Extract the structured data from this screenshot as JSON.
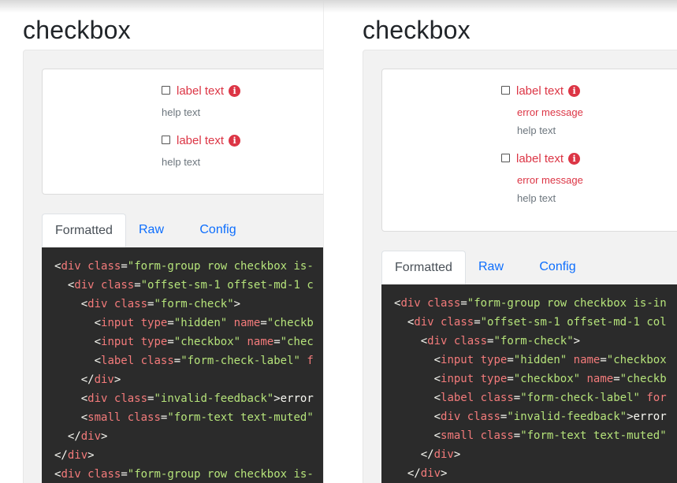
{
  "left": {
    "title": "checkbox",
    "checks": [
      {
        "label": "label text",
        "help": "help text"
      },
      {
        "label": "label text",
        "help": "help text"
      }
    ],
    "tabs": [
      "Formatted",
      "Raw",
      "Config"
    ],
    "code": [
      [
        [
          "<",
          "p"
        ],
        [
          "div",
          "g"
        ],
        [
          " ",
          ""
        ],
        [
          "class",
          "a"
        ],
        [
          "=",
          "p"
        ],
        [
          "\"form-group row checkbox is-",
          "v"
        ]
      ],
      [
        [
          "  ",
          ""
        ],
        [
          "<",
          "p"
        ],
        [
          "div",
          "g"
        ],
        [
          " ",
          ""
        ],
        [
          "class",
          "a"
        ],
        [
          "=",
          "p"
        ],
        [
          "\"offset-sm-1 offset-md-1 c",
          "v"
        ]
      ],
      [
        [
          "    ",
          ""
        ],
        [
          "<",
          "p"
        ],
        [
          "div",
          "g"
        ],
        [
          " ",
          ""
        ],
        [
          "class",
          "a"
        ],
        [
          "=",
          "p"
        ],
        [
          "\"form-check\"",
          "v"
        ],
        [
          ">",
          "p"
        ]
      ],
      [
        [
          "      ",
          ""
        ],
        [
          "<",
          "p"
        ],
        [
          "input",
          "g"
        ],
        [
          " ",
          ""
        ],
        [
          "type",
          "a"
        ],
        [
          "=",
          "p"
        ],
        [
          "\"hidden\"",
          "v"
        ],
        [
          " ",
          ""
        ],
        [
          "name",
          "a"
        ],
        [
          "=",
          "p"
        ],
        [
          "\"checkb",
          "v"
        ]
      ],
      [
        [
          "      ",
          ""
        ],
        [
          "<",
          "p"
        ],
        [
          "input",
          "g"
        ],
        [
          " ",
          ""
        ],
        [
          "type",
          "a"
        ],
        [
          "=",
          "p"
        ],
        [
          "\"checkbox\"",
          "v"
        ],
        [
          " ",
          ""
        ],
        [
          "name",
          "a"
        ],
        [
          "=",
          "p"
        ],
        [
          "\"chec",
          "v"
        ]
      ],
      [
        [
          "      ",
          ""
        ],
        [
          "<",
          "p"
        ],
        [
          "label",
          "g"
        ],
        [
          " ",
          ""
        ],
        [
          "class",
          "a"
        ],
        [
          "=",
          "p"
        ],
        [
          "\"form-check-label\"",
          "v"
        ],
        [
          " ",
          ""
        ],
        [
          "f",
          "a"
        ]
      ],
      [
        [
          "    ",
          ""
        ],
        [
          "</",
          "p"
        ],
        [
          "div",
          "g"
        ],
        [
          ">",
          "p"
        ]
      ],
      [
        [
          "    ",
          ""
        ],
        [
          "<",
          "p"
        ],
        [
          "div",
          "g"
        ],
        [
          " ",
          ""
        ],
        [
          "class",
          "a"
        ],
        [
          "=",
          "p"
        ],
        [
          "\"invalid-feedback\"",
          "v"
        ],
        [
          ">",
          "p"
        ],
        [
          "error",
          "t"
        ]
      ],
      [
        [
          "    ",
          ""
        ],
        [
          "<",
          "p"
        ],
        [
          "small",
          "g"
        ],
        [
          " ",
          ""
        ],
        [
          "class",
          "a"
        ],
        [
          "=",
          "p"
        ],
        [
          "\"form-text text-muted\"",
          "v"
        ]
      ],
      [
        [
          "  ",
          ""
        ],
        [
          "</",
          "p"
        ],
        [
          "div",
          "g"
        ],
        [
          ">",
          "p"
        ]
      ],
      [
        [
          "</",
          "p"
        ],
        [
          "div",
          "g"
        ],
        [
          ">",
          "p"
        ]
      ],
      [
        [
          "<",
          "p"
        ],
        [
          "div",
          "g"
        ],
        [
          " ",
          ""
        ],
        [
          "class",
          "a"
        ],
        [
          "=",
          "p"
        ],
        [
          "\"form-group row checkbox is-",
          "v"
        ]
      ]
    ]
  },
  "right": {
    "title": "checkbox",
    "checks": [
      {
        "label": "label text",
        "error": "error message",
        "help": "help text"
      },
      {
        "label": "label text",
        "error": "error message",
        "help": "help text"
      }
    ],
    "tabs": [
      "Formatted",
      "Raw",
      "Config"
    ],
    "code": [
      [
        [
          "<",
          "p"
        ],
        [
          "div",
          "g"
        ],
        [
          " ",
          ""
        ],
        [
          "class",
          "a"
        ],
        [
          "=",
          "p"
        ],
        [
          "\"form-group row checkbox is-in",
          "v"
        ]
      ],
      [
        [
          "  ",
          ""
        ],
        [
          "<",
          "p"
        ],
        [
          "div",
          "g"
        ],
        [
          " ",
          ""
        ],
        [
          "class",
          "a"
        ],
        [
          "=",
          "p"
        ],
        [
          "\"offset-sm-1 offset-md-1 col",
          "v"
        ]
      ],
      [
        [
          "    ",
          ""
        ],
        [
          "<",
          "p"
        ],
        [
          "div",
          "g"
        ],
        [
          " ",
          ""
        ],
        [
          "class",
          "a"
        ],
        [
          "=",
          "p"
        ],
        [
          "\"form-check\"",
          "v"
        ],
        [
          ">",
          "p"
        ]
      ],
      [
        [
          "      ",
          ""
        ],
        [
          "<",
          "p"
        ],
        [
          "input",
          "g"
        ],
        [
          " ",
          ""
        ],
        [
          "type",
          "a"
        ],
        [
          "=",
          "p"
        ],
        [
          "\"hidden\"",
          "v"
        ],
        [
          " ",
          ""
        ],
        [
          "name",
          "a"
        ],
        [
          "=",
          "p"
        ],
        [
          "\"checkbox",
          "v"
        ]
      ],
      [
        [
          "      ",
          ""
        ],
        [
          "<",
          "p"
        ],
        [
          "input",
          "g"
        ],
        [
          " ",
          ""
        ],
        [
          "type",
          "a"
        ],
        [
          "=",
          "p"
        ],
        [
          "\"checkbox\"",
          "v"
        ],
        [
          " ",
          ""
        ],
        [
          "name",
          "a"
        ],
        [
          "=",
          "p"
        ],
        [
          "\"checkb",
          "v"
        ]
      ],
      [
        [
          "      ",
          ""
        ],
        [
          "<",
          "p"
        ],
        [
          "label",
          "g"
        ],
        [
          " ",
          ""
        ],
        [
          "class",
          "a"
        ],
        [
          "=",
          "p"
        ],
        [
          "\"form-check-label\"",
          "v"
        ],
        [
          " ",
          ""
        ],
        [
          "for",
          "a"
        ]
      ],
      [
        [
          "      ",
          ""
        ],
        [
          "<",
          "p"
        ],
        [
          "div",
          "g"
        ],
        [
          " ",
          ""
        ],
        [
          "class",
          "a"
        ],
        [
          "=",
          "p"
        ],
        [
          "\"invalid-feedback\"",
          "v"
        ],
        [
          ">",
          "p"
        ],
        [
          "error",
          "t"
        ]
      ],
      [
        [
          "      ",
          ""
        ],
        [
          "<",
          "p"
        ],
        [
          "small",
          "g"
        ],
        [
          " ",
          ""
        ],
        [
          "class",
          "a"
        ],
        [
          "=",
          "p"
        ],
        [
          "\"form-text text-muted\"",
          "v"
        ]
      ],
      [
        [
          "    ",
          ""
        ],
        [
          "</",
          "p"
        ],
        [
          "div",
          "g"
        ],
        [
          ">",
          "p"
        ]
      ],
      [
        [
          "  ",
          ""
        ],
        [
          "</",
          "p"
        ],
        [
          "div",
          "g"
        ],
        [
          ">",
          "p"
        ]
      ]
    ]
  },
  "colors": {
    "error": "#dc3545",
    "muted": "#6c757d",
    "link": "#0d6efd",
    "code_bg": "#2b2b2b",
    "code_tag": "#f47b7b",
    "code_value": "#b5e37a"
  },
  "icons": {
    "info": "info-circle-icon"
  }
}
